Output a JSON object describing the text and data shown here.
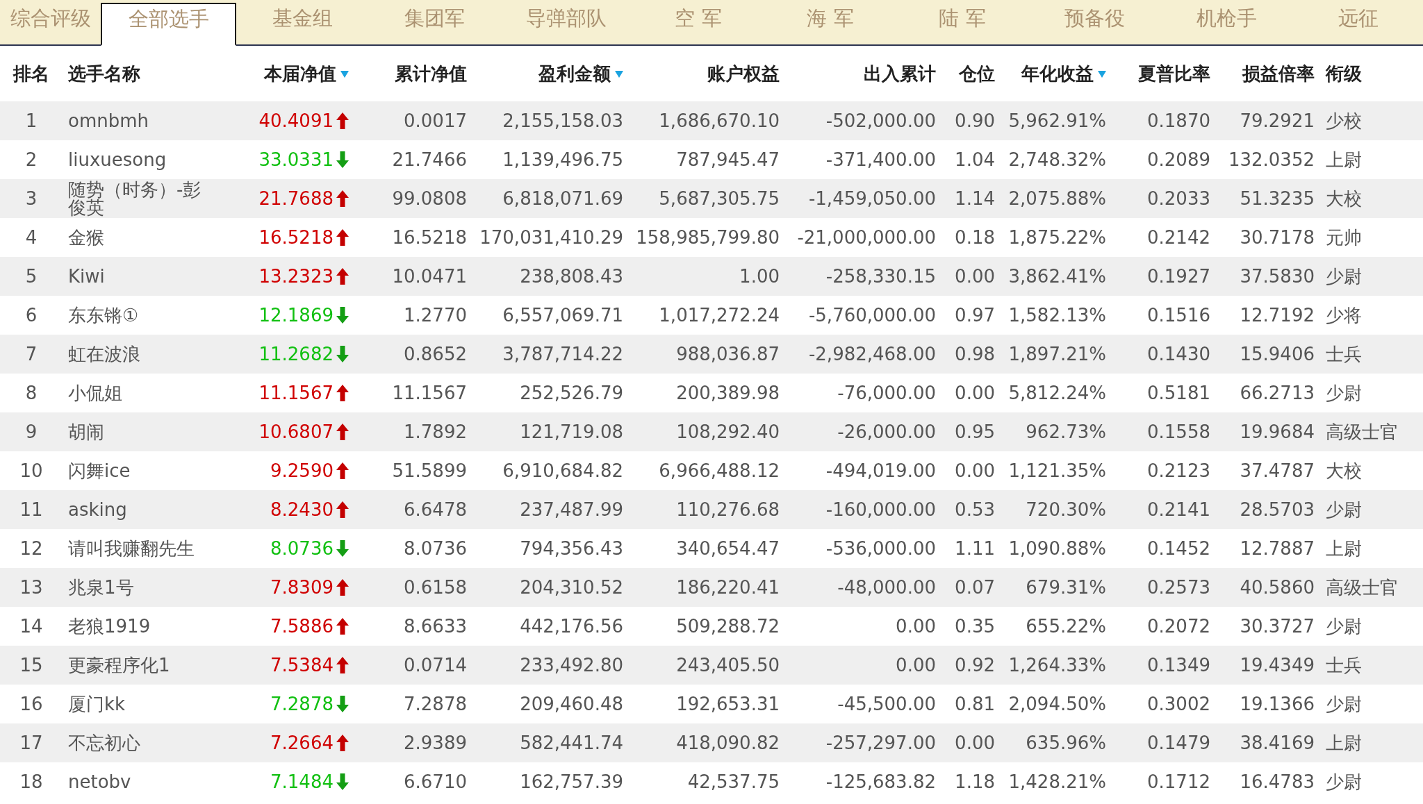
{
  "tabs": [
    {
      "label": "综合评级",
      "selected": false
    },
    {
      "label": "全部选手",
      "selected": true
    },
    {
      "label": "基金组",
      "selected": false
    },
    {
      "label": "集团军",
      "selected": false
    },
    {
      "label": "导弹部队",
      "selected": false
    },
    {
      "label": "空 军",
      "selected": false
    },
    {
      "label": "海 军",
      "selected": false
    },
    {
      "label": "陆 军",
      "selected": false
    },
    {
      "label": "预备役",
      "selected": false
    },
    {
      "label": "机枪手",
      "selected": false
    },
    {
      "label": "远征",
      "selected": false
    }
  ],
  "table": {
    "columns": [
      {
        "label": "排名",
        "sort_indicator": false
      },
      {
        "label": "选手名称",
        "sort_indicator": false
      },
      {
        "label": "本届净值",
        "sort_indicator": true
      },
      {
        "label": "累计净值",
        "sort_indicator": false
      },
      {
        "label": "盈利金额",
        "sort_indicator": true
      },
      {
        "label": "账户权益",
        "sort_indicator": false
      },
      {
        "label": "出入累计",
        "sort_indicator": false
      },
      {
        "label": "仓位",
        "sort_indicator": false
      },
      {
        "label": "年化收益",
        "sort_indicator": true
      },
      {
        "label": "夏普比率",
        "sort_indicator": false
      },
      {
        "label": "损益倍率",
        "sort_indicator": false
      },
      {
        "label": "衔级",
        "sort_indicator": false
      }
    ],
    "rows": [
      {
        "cells": [
          "1",
          "omnbmh",
          "40.4091",
          "0.0017",
          "2,155,158.03",
          "1,686,670.10",
          "-502,000.00",
          "0.90",
          "5,962.91%",
          "0.1870",
          "79.2921",
          "少校"
        ],
        "rising": true
      },
      {
        "cells": [
          "2",
          "liuxuesong",
          "33.0331",
          "21.7466",
          "1,139,496.75",
          "787,945.47",
          "-371,400.00",
          "1.04",
          "2,748.32%",
          "0.2089",
          "132.0352",
          "上尉"
        ],
        "rising": false
      },
      {
        "cells": [
          "3",
          "随势（时务）-彭俊英",
          "21.7688",
          "99.0808",
          "6,818,071.69",
          "5,687,305.75",
          "-1,459,050.00",
          "1.14",
          "2,075.88%",
          "0.2033",
          "51.3235",
          "大校"
        ],
        "rising": true
      },
      {
        "cells": [
          "4",
          "金猴",
          "16.5218",
          "16.5218",
          "170,031,410.29",
          "158,985,799.80",
          "-21,000,000.00",
          "0.18",
          "1,875.22%",
          "0.2142",
          "30.7178",
          "元帅"
        ],
        "rising": true
      },
      {
        "cells": [
          "5",
          "Kiwi",
          "13.2323",
          "10.0471",
          "238,808.43",
          "1.00",
          "-258,330.15",
          "0.00",
          "3,862.41%",
          "0.1927",
          "37.5830",
          "少尉"
        ],
        "rising": true
      },
      {
        "cells": [
          "6",
          "东东锵①",
          "12.1869",
          "1.2770",
          "6,557,069.71",
          "1,017,272.24",
          "-5,760,000.00",
          "0.97",
          "1,582.13%",
          "0.1516",
          "12.7192",
          "少将"
        ],
        "rising": false
      },
      {
        "cells": [
          "7",
          "虹在波浪",
          "11.2682",
          "0.8652",
          "3,787,714.22",
          "988,036.87",
          "-2,982,468.00",
          "0.98",
          "1,897.21%",
          "0.1430",
          "15.9406",
          "士兵"
        ],
        "rising": false
      },
      {
        "cells": [
          "8",
          "小侃姐",
          "11.1567",
          "11.1567",
          "252,526.79",
          "200,389.98",
          "-76,000.00",
          "0.00",
          "5,812.24%",
          "0.5181",
          "66.2713",
          "少尉"
        ],
        "rising": true
      },
      {
        "cells": [
          "9",
          "胡闹",
          "10.6807",
          "1.7892",
          "121,719.08",
          "108,292.40",
          "-26,000.00",
          "0.95",
          "962.73%",
          "0.1558",
          "19.9684",
          "高级士官"
        ],
        "rising": true
      },
      {
        "cells": [
          "10",
          "闪舞ice",
          "9.2590",
          "51.5899",
          "6,910,684.82",
          "6,966,488.12",
          "-494,019.00",
          "0.00",
          "1,121.35%",
          "0.2123",
          "37.4787",
          "大校"
        ],
        "rising": true
      },
      {
        "cells": [
          "11",
          "asking",
          "8.2430",
          "6.6478",
          "237,487.99",
          "110,276.68",
          "-160,000.00",
          "0.53",
          "720.30%",
          "0.2141",
          "28.5703",
          "少尉"
        ],
        "rising": true
      },
      {
        "cells": [
          "12",
          "请叫我赚翻先生",
          "8.0736",
          "8.0736",
          "794,356.43",
          "340,654.47",
          "-536,000.00",
          "1.11",
          "1,090.88%",
          "0.1452",
          "12.7887",
          "上尉"
        ],
        "rising": false
      },
      {
        "cells": [
          "13",
          "兆泉1号",
          "7.8309",
          "0.6158",
          "204,310.52",
          "186,220.41",
          "-48,000.00",
          "0.07",
          "679.31%",
          "0.2573",
          "40.5860",
          "高级士官"
        ],
        "rising": true
      },
      {
        "cells": [
          "14",
          "老狼1919",
          "7.5886",
          "8.6633",
          "442,176.56",
          "509,288.72",
          "0.00",
          "0.35",
          "655.22%",
          "0.2072",
          "30.3727",
          "少尉"
        ],
        "rising": true
      },
      {
        "cells": [
          "15",
          "更豪程序化1",
          "7.5384",
          "0.0714",
          "233,492.80",
          "243,405.50",
          "0.00",
          "0.92",
          "1,264.33%",
          "0.1349",
          "19.4349",
          "士兵"
        ],
        "rising": true
      },
      {
        "cells": [
          "16",
          "厦门kk",
          "7.2878",
          "7.2878",
          "209,460.48",
          "192,653.31",
          "-45,500.00",
          "0.81",
          "2,094.50%",
          "0.3002",
          "19.1366",
          "少尉"
        ],
        "rising": false
      },
      {
        "cells": [
          "17",
          "不忘初心",
          "7.2664",
          "2.9389",
          "582,441.74",
          "418,090.82",
          "-257,297.00",
          "0.00",
          "635.96%",
          "0.1479",
          "38.4169",
          "上尉"
        ],
        "rising": true
      },
      {
        "cells": [
          "18",
          "netobv",
          "7.1484",
          "6.6710",
          "162,757.39",
          "42,537.75",
          "-125,683.82",
          "1.18",
          "1,428.21%",
          "0.1712",
          "16.4783",
          "少尉"
        ],
        "rising": false
      }
    ]
  }
}
